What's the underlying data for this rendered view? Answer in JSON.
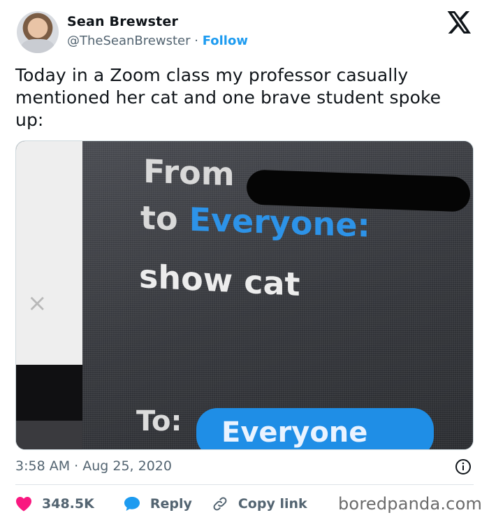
{
  "author": {
    "name": "Sean Brewster",
    "handle": "@TheSeanBrewster",
    "separator": "·",
    "follow_label": "Follow"
  },
  "tweet": {
    "text": "Today in a Zoom class my professor casually mentioned her cat and one brave student spoke up:",
    "timestamp": "3:58 AM · Aug 25, 2020"
  },
  "media": {
    "chat_from": "From",
    "chat_to_prefix": "to ",
    "chat_to_target": "Everyone:",
    "chat_message": "show cat",
    "to_label": "To:",
    "to_pill": "Everyone",
    "close_glyph": "×"
  },
  "actions": {
    "likes": "348.5K",
    "reply_label": "Reply",
    "copy_label": "Copy link"
  },
  "footer": {
    "watermark": "boredpanda.com"
  },
  "icons": {
    "platform": "x-logo-icon",
    "info": "info-icon",
    "like": "heart-icon",
    "reply": "speech-bubble-icon",
    "copy": "link-icon"
  },
  "colors": {
    "accent": "#1d9bf0",
    "like": "#f91880",
    "muted": "#536471"
  }
}
